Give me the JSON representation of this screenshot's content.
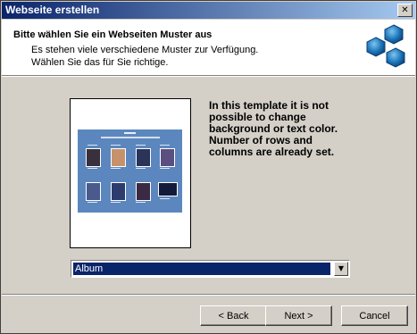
{
  "window": {
    "title": "Webseite erstellen",
    "close_glyph": "✕"
  },
  "header": {
    "title": "Bitte wählen Sie ein Webseiten Muster aus",
    "line1": "Es stehen viele verschiedene Muster zur Verfügung.",
    "line2": "Wählen Sie das für Sie richtige.",
    "logo_icon": "blue-hexagons-icon"
  },
  "main": {
    "description": "In this template it is not\npossible to change\nbackground or text color.\nNumber of rows and\ncolumns are already set.",
    "template_select": {
      "selected": "Album",
      "arrow_glyph": "▼"
    }
  },
  "buttons": {
    "back": "< Back",
    "next": "Next >",
    "cancel": "Cancel"
  },
  "colors": {
    "title_bar_start": "#0a246a",
    "title_bar_end": "#a6caf0",
    "selection": "#0a246a",
    "album_background": "#5b87be",
    "logo": "#1a74b8"
  }
}
